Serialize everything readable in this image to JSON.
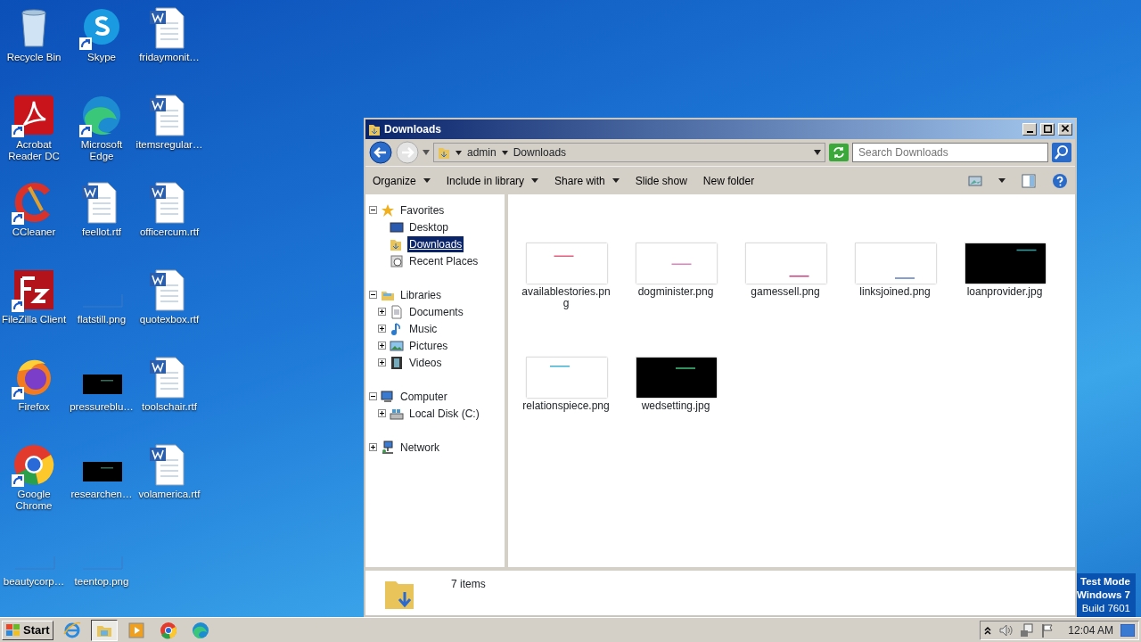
{
  "desktop": {
    "icons": [
      {
        "label": "Recycle Bin",
        "kind": "recycle",
        "shortcut": false
      },
      {
        "label": "Skype",
        "kind": "skype",
        "shortcut": true
      },
      {
        "label": "fridaymonit…",
        "kind": "word",
        "shortcut": false
      },
      {
        "label": "Acrobat Reader DC",
        "kind": "acrobat",
        "shortcut": true
      },
      {
        "label": "Microsoft Edge",
        "kind": "edge",
        "shortcut": true
      },
      {
        "label": "itemsregular…",
        "kind": "word",
        "shortcut": false
      },
      {
        "label": "CCleaner",
        "kind": "ccleaner",
        "shortcut": true
      },
      {
        "label": "feellot.rtf",
        "kind": "word",
        "shortcut": false
      },
      {
        "label": "officercum.rtf",
        "kind": "word",
        "shortcut": false
      },
      {
        "label": "FileZilla Client",
        "kind": "filezilla",
        "shortcut": true
      },
      {
        "label": "flatstill.png",
        "kind": "blank",
        "shortcut": false
      },
      {
        "label": "quotexbox.rtf",
        "kind": "word",
        "shortcut": false
      },
      {
        "label": "Firefox",
        "kind": "firefox",
        "shortcut": true
      },
      {
        "label": "pressureblu…",
        "kind": "dark",
        "shortcut": false
      },
      {
        "label": "toolschair.rtf",
        "kind": "word",
        "shortcut": false
      },
      {
        "label": "Google Chrome",
        "kind": "chrome",
        "shortcut": true
      },
      {
        "label": "researchen…",
        "kind": "dark",
        "shortcut": false
      },
      {
        "label": "volamerica.rtf",
        "kind": "word",
        "shortcut": false
      },
      {
        "label": "beautycorp…",
        "kind": "blank",
        "shortcut": false
      },
      {
        "label": "teentop.png",
        "kind": "blank",
        "shortcut": false
      }
    ],
    "test_mode": [
      "Test Mode",
      "Windows 7",
      "Build 7601"
    ]
  },
  "window": {
    "title": "Downloads",
    "breadcrumb": [
      "admin",
      "Downloads"
    ],
    "search": {
      "placeholder": "Search Downloads"
    },
    "toolbar": [
      {
        "label": "Organize",
        "menu": true
      },
      {
        "label": "Include in library",
        "menu": true
      },
      {
        "label": "Share with",
        "menu": true
      },
      {
        "label": "Slide show",
        "menu": false
      },
      {
        "label": "New folder",
        "menu": false
      }
    ],
    "nav": [
      {
        "label": "Favorites",
        "kind": "star",
        "expanded": true,
        "selected": false,
        "children": [
          {
            "label": "Desktop",
            "kind": "desktop",
            "selected": false
          },
          {
            "label": "Downloads",
            "kind": "downloads",
            "selected": true
          },
          {
            "label": "Recent Places",
            "kind": "recent",
            "selected": false
          }
        ]
      },
      {
        "label": "Libraries",
        "kind": "library",
        "expanded": true,
        "selected": false,
        "children": [
          {
            "label": "Documents",
            "kind": "document",
            "expanded": false,
            "selected": false
          },
          {
            "label": "Music",
            "kind": "music",
            "expanded": false,
            "selected": false
          },
          {
            "label": "Pictures",
            "kind": "pictures",
            "expanded": false,
            "selected": false
          },
          {
            "label": "Videos",
            "kind": "videos",
            "expanded": false,
            "selected": false
          }
        ]
      },
      {
        "label": "Computer",
        "kind": "computer",
        "expanded": true,
        "selected": false,
        "children": [
          {
            "label": "Local Disk (C:)",
            "kind": "disk",
            "expanded": false,
            "selected": false
          }
        ]
      },
      {
        "label": "Network",
        "kind": "network",
        "expanded": false,
        "selected": false
      }
    ],
    "files": [
      {
        "name": "availablestories.png",
        "kind": "picture"
      },
      {
        "name": "dogminister.png",
        "kind": "picture"
      },
      {
        "name": "gamessell.png",
        "kind": "picture"
      },
      {
        "name": "linksjoined.png",
        "kind": "picture"
      },
      {
        "name": "loanprovider.jpg",
        "kind": "picture"
      },
      {
        "name": "relationspiece.png",
        "kind": "picture"
      },
      {
        "name": "wedsetting.jpg",
        "kind": "picture"
      }
    ],
    "item_count": "7 items"
  },
  "taskbar": {
    "start": "Start",
    "apps": [
      {
        "kind": "ie",
        "active": false
      },
      {
        "kind": "explorer",
        "active": true
      },
      {
        "kind": "media",
        "active": false
      },
      {
        "kind": "chrome",
        "active": false
      },
      {
        "kind": "edge",
        "active": false
      }
    ],
    "clock": "12:04 AM"
  }
}
